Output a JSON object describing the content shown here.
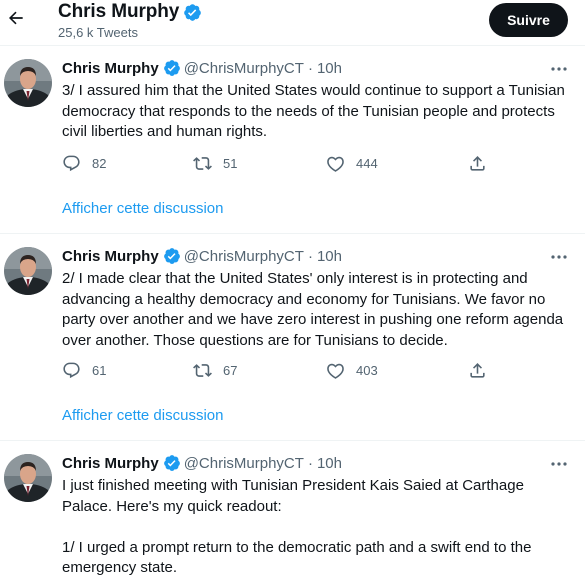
{
  "header": {
    "name": "Chris Murphy",
    "tweet_count": "25,6 k Tweets",
    "follow_label": "Suivre"
  },
  "colors": {
    "verified": "#1d9bf0",
    "link": "#1d9bf0",
    "secondary_text": "#536471",
    "primary_text": "#0f1419",
    "follow_bg": "#0f1419"
  },
  "tweets": [
    {
      "name": "Chris Murphy",
      "handle": "@ChrisMurphyCT",
      "dot": "·",
      "time": "10h",
      "text": "3/ I assured him that the United States would continue to support a Tunisian democracy that responds to the needs of the Tunisian people and protects civil liberties and human rights.",
      "replies": "82",
      "retweets": "51",
      "likes": "444",
      "show_thread": "Afficher cette discussion"
    },
    {
      "name": "Chris Murphy",
      "handle": "@ChrisMurphyCT",
      "dot": "·",
      "time": "10h",
      "text": "2/ I made clear that the United States' only interest is in protecting and advancing a healthy democracy and economy for Tunisians. We favor no party over another and we have zero interest in pushing one reform agenda over another. Those questions are for Tunisians to decide.",
      "replies": "61",
      "retweets": "67",
      "likes": "403",
      "show_thread": "Afficher cette discussion"
    },
    {
      "name": "Chris Murphy",
      "handle": "@ChrisMurphyCT",
      "dot": "·",
      "time": "10h",
      "text": "I just finished meeting with Tunisian President Kais Saied at Carthage Palace. Here's my quick readout:\n\n1/ I urged a prompt return to the democratic path and a swift end to the emergency state."
    }
  ],
  "icons": {
    "back": "arrow-left-icon",
    "verified": "verified-badge-icon",
    "more": "more-dots-icon",
    "reply": "reply-icon",
    "retweet": "retweet-icon",
    "like": "heart-icon",
    "share": "share-icon"
  }
}
